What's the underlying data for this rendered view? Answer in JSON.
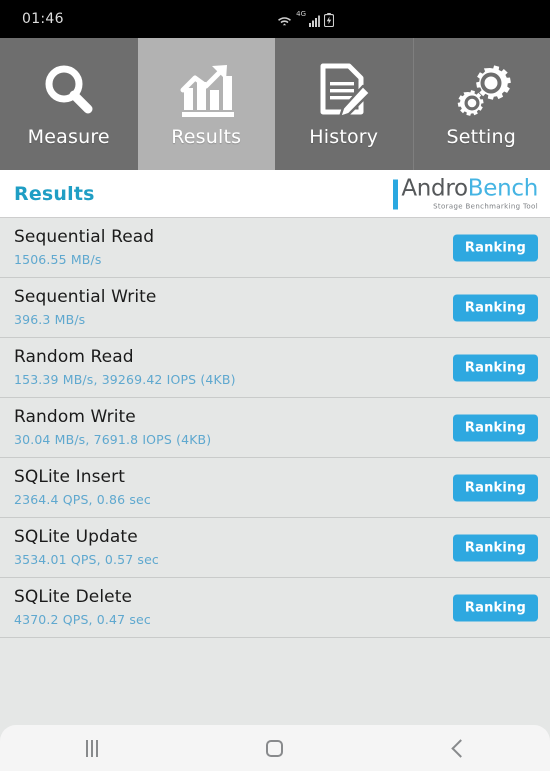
{
  "statusbar": {
    "time": "01:46",
    "network_label": "4G",
    "icons": [
      "wifi-icon",
      "cellular-signal-icon",
      "battery-icon"
    ]
  },
  "tabs": [
    {
      "label": "Measure",
      "icon": "magnifier-icon",
      "active": false
    },
    {
      "label": "Results",
      "icon": "bar-chart-trend-icon",
      "active": true
    },
    {
      "label": "History",
      "icon": "document-pencil-icon",
      "active": false
    },
    {
      "label": "Setting",
      "icon": "gears-icon",
      "active": false
    }
  ],
  "header": {
    "title": "Results",
    "logo_primary": "Andro",
    "logo_secondary": "Bench",
    "logo_tagline": "Storage Benchmarking Tool"
  },
  "results": [
    {
      "title": "Sequential Read",
      "value": "1506.55 MB/s",
      "button": "Ranking"
    },
    {
      "title": "Sequential Write",
      "value": "396.3 MB/s",
      "button": "Ranking"
    },
    {
      "title": "Random Read",
      "value": "153.39 MB/s, 39269.42 IOPS (4KB)",
      "button": "Ranking"
    },
    {
      "title": "Random Write",
      "value": "30.04 MB/s, 7691.8 IOPS (4KB)",
      "button": "Ranking"
    },
    {
      "title": "SQLite Insert",
      "value": "2364.4 QPS, 0.86 sec",
      "button": "Ranking"
    },
    {
      "title": "SQLite Update",
      "value": "3534.01 QPS, 0.57 sec",
      "button": "Ranking"
    },
    {
      "title": "SQLite Delete",
      "value": "4370.2 QPS, 0.47 sec",
      "button": "Ranking"
    }
  ],
  "navbar": {
    "recents": "recents-icon",
    "home": "home-icon",
    "back": "back-icon"
  },
  "colors": {
    "accent_blue": "#2ea8e0",
    "value_blue": "#5fa8cf",
    "header_blue": "#1f9ec4",
    "tab_inactive": "#6e6e6e",
    "tab_active": "#b2b2b2",
    "page_bg": "#e5e7e6"
  }
}
